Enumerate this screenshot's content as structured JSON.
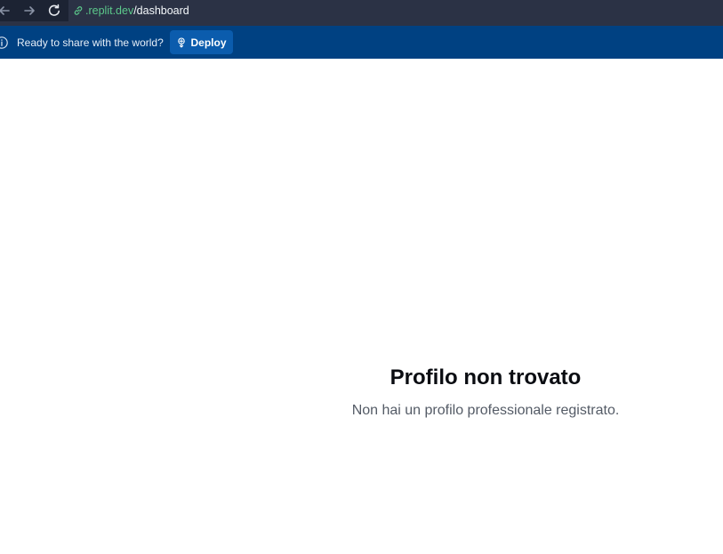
{
  "browser": {
    "url_host": ".replit.dev",
    "url_path": "/dashboard"
  },
  "banner": {
    "message": "Ready to share with the world?",
    "deploy_label": "Deploy"
  },
  "main": {
    "title": "Profilo non trovato",
    "subtitle": "Non hai un profilo professionale registrato."
  },
  "icons": {
    "back": "arrow-left-icon",
    "forward": "arrow-right-icon",
    "reload": "reload-icon",
    "link": "link-icon",
    "info": "info-icon",
    "deploy": "deploy-icon"
  },
  "colors": {
    "browser_bg": "#1c2333",
    "url_bg": "#2b3245",
    "url_host": "#5cc98b",
    "banner_bg": "#004182",
    "deploy_button_bg": "#0b5cad",
    "title": "#0b0d12",
    "subtitle": "#545b66"
  }
}
